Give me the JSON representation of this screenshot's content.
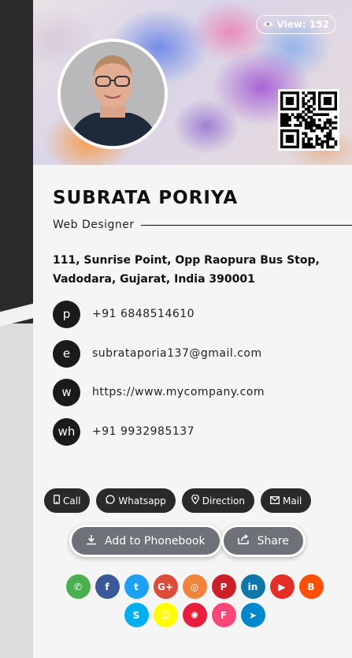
{
  "profile": {
    "views_label": "View: 152",
    "name": "SUBRATA PORIYA",
    "role": "Web Designer",
    "address": "111, Sunrise Point, Opp Raopura Bus Stop, Vadodara, Gujarat, India 390001"
  },
  "contacts": [
    {
      "badge": "p",
      "value": "+91 6848514610",
      "icon": "phone"
    },
    {
      "badge": "e",
      "value": "subrataporia137@gmail.com",
      "icon": "email"
    },
    {
      "badge": "w",
      "value": "https://www.mycompany.com",
      "icon": "website"
    },
    {
      "badge": "wh",
      "value": "+91 9932985137",
      "icon": "whatsapp"
    }
  ],
  "actions": {
    "call": "Call",
    "whatsapp": "Whatsapp",
    "direction": "Direction",
    "mail": "Mail",
    "add_to_phonebook": "Add to Phonebook",
    "share": "Share"
  },
  "social_icons": [
    {
      "name": "whatsapp",
      "color": "#4caf50",
      "glyph": "✆"
    },
    {
      "name": "facebook",
      "color": "#3b5998",
      "glyph": "f"
    },
    {
      "name": "twitter",
      "color": "#1da1f2",
      "glyph": "t"
    },
    {
      "name": "google-plus",
      "color": "#dd4b39",
      "glyph": "G+"
    },
    {
      "name": "instagram",
      "color": "#f0843c",
      "glyph": "◎"
    },
    {
      "name": "pinterest",
      "color": "#cb2027",
      "glyph": "P"
    },
    {
      "name": "linkedin",
      "color": "#0e76a8",
      "glyph": "in"
    },
    {
      "name": "youtube",
      "color": "#e52d27",
      "glyph": "▶"
    },
    {
      "name": "blogger",
      "color": "#fc4f08",
      "glyph": "B"
    },
    {
      "name": "skype",
      "color": "#00aff0",
      "glyph": "S"
    },
    {
      "name": "snapchat",
      "color": "#fffc00",
      "glyph": "☺"
    },
    {
      "name": "dribbble-like",
      "color": "#e91e3c",
      "glyph": "✺"
    },
    {
      "name": "foursquare",
      "color": "#f94877",
      "glyph": "F"
    },
    {
      "name": "telegram",
      "color": "#0088cc",
      "glyph": "➤"
    }
  ]
}
